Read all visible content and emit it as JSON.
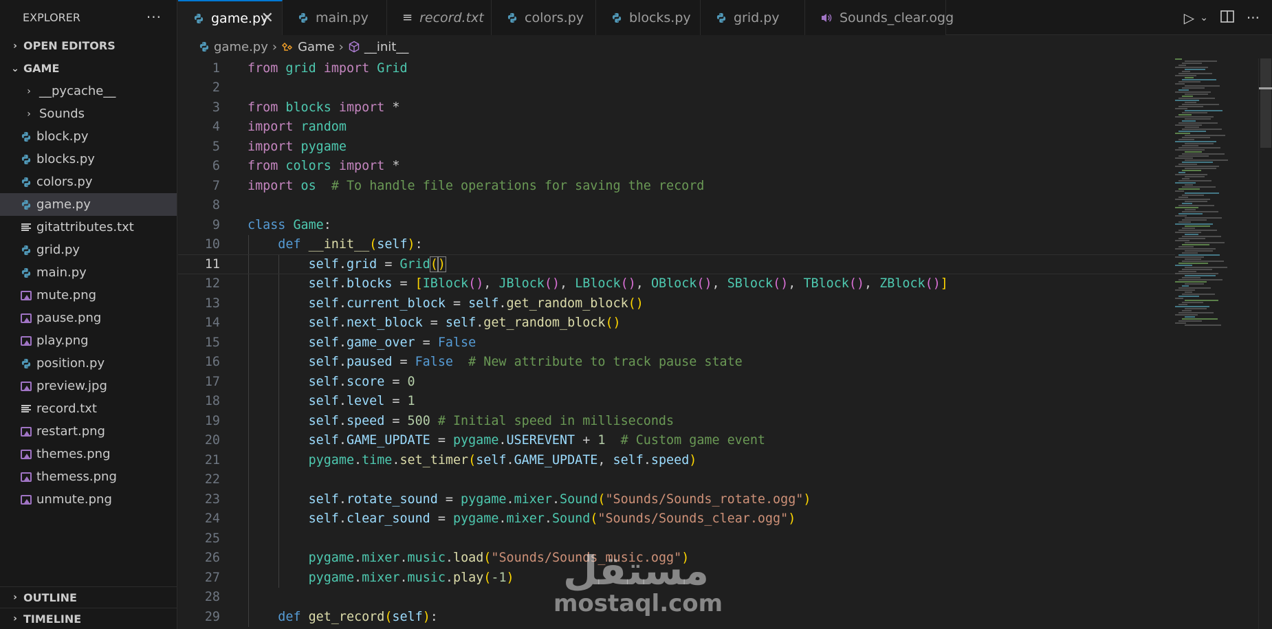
{
  "explorer": {
    "title": "EXPLORER",
    "more": "···",
    "open_editors": "OPEN EDITORS",
    "workspace": "GAME",
    "items": [
      {
        "label": "__pycache__",
        "type": "folder"
      },
      {
        "label": "Sounds",
        "type": "folder"
      },
      {
        "label": "block.py",
        "type": "py"
      },
      {
        "label": "blocks.py",
        "type": "py"
      },
      {
        "label": "colors.py",
        "type": "py"
      },
      {
        "label": "game.py",
        "type": "py",
        "selected": true
      },
      {
        "label": "gitattributes.txt",
        "type": "txt"
      },
      {
        "label": "grid.py",
        "type": "py"
      },
      {
        "label": "main.py",
        "type": "py"
      },
      {
        "label": "mute.png",
        "type": "img"
      },
      {
        "label": "pause.png",
        "type": "img"
      },
      {
        "label": "play.png",
        "type": "img"
      },
      {
        "label": "position.py",
        "type": "py"
      },
      {
        "label": "preview.jpg",
        "type": "img"
      },
      {
        "label": "record.txt",
        "type": "txt"
      },
      {
        "label": "restart.png",
        "type": "img"
      },
      {
        "label": "themes.png",
        "type": "img"
      },
      {
        "label": "themess.png",
        "type": "img"
      },
      {
        "label": "unmute.png",
        "type": "img"
      }
    ],
    "outline": "OUTLINE",
    "timeline": "TIMELINE"
  },
  "tabs": [
    {
      "label": "game.py",
      "icon": "python-icon",
      "active": true,
      "close": "✕"
    },
    {
      "label": "main.py",
      "icon": "python-icon"
    },
    {
      "label": "record.txt",
      "icon": "text-file-icon",
      "italic": true
    },
    {
      "label": "colors.py",
      "icon": "python-icon"
    },
    {
      "label": "blocks.py",
      "icon": "python-icon"
    },
    {
      "label": "grid.py",
      "icon": "python-icon"
    },
    {
      "label": "Sounds_clear.ogg",
      "icon": "audio-icon"
    }
  ],
  "breadcrumb": {
    "file": "game.py",
    "class": "Game",
    "method": "__init__"
  },
  "editor": {
    "current_line": 11,
    "line_numbers": [
      "1",
      "2",
      "3",
      "4",
      "5",
      "6",
      "7",
      "8",
      "9",
      "10",
      "11",
      "12",
      "13",
      "14",
      "15",
      "16",
      "17",
      "18",
      "19",
      "20",
      "21",
      "22",
      "23",
      "24",
      "25",
      "26",
      "27",
      "28",
      "29"
    ]
  },
  "watermark": {
    "arabic": "مستقل",
    "latin": "mostaql.com"
  },
  "colors": {
    "accent": "#0078d4",
    "python": "#519aba",
    "image": "#a074c4",
    "keyword": "#c586c0",
    "builtin": "#569cd6",
    "class": "#4ec9b0",
    "function": "#dcdcaa",
    "variable": "#9cdcfe",
    "number": "#b5cea8",
    "string": "#ce9178",
    "comment": "#6a9955"
  }
}
